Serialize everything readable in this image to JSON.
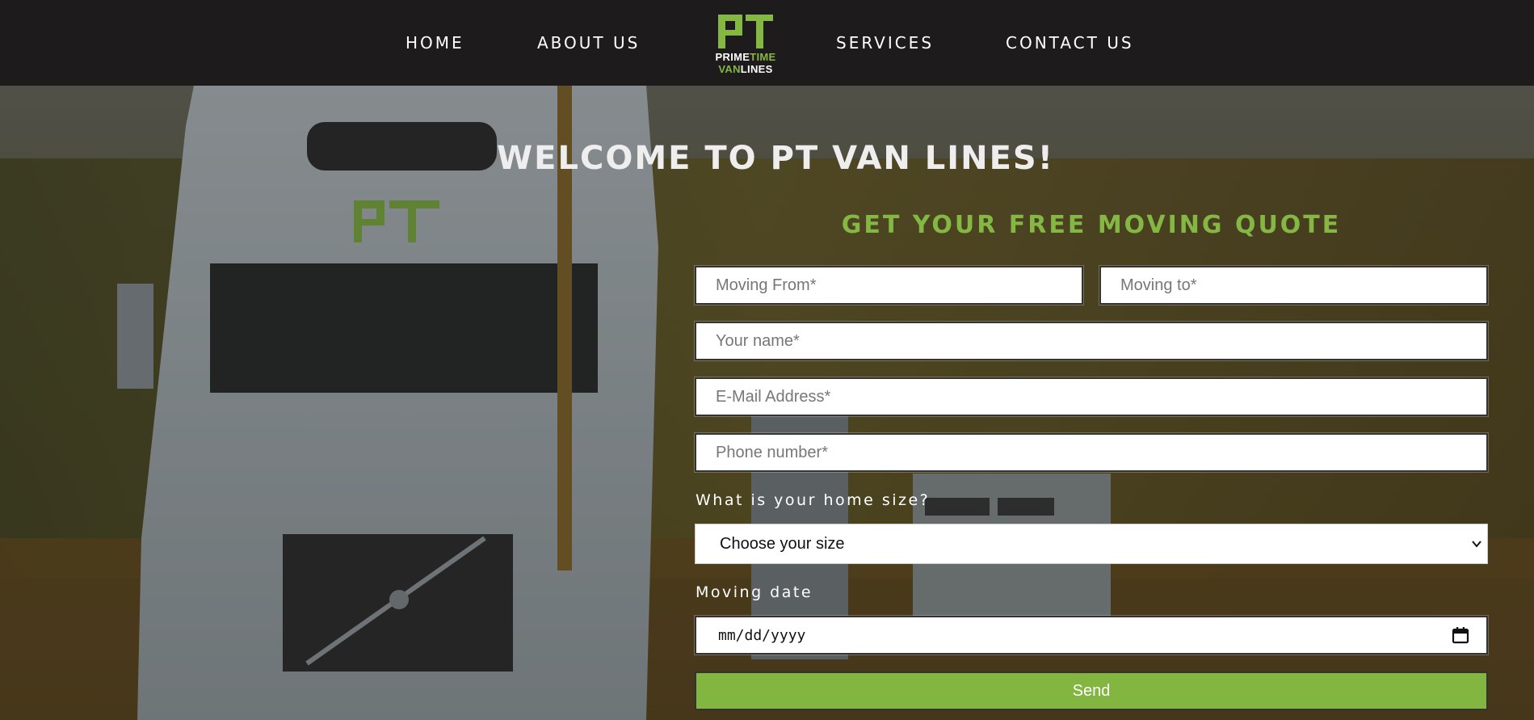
{
  "nav": {
    "home": "HOME",
    "about": "ABOUT US",
    "services": "SERVICES",
    "contact": "CONTACT US"
  },
  "logo": {
    "mark": "PT",
    "prime": "PRIME",
    "time": "TIME",
    "van": "VAN",
    "lines": "LINES"
  },
  "hero": {
    "welcome": "WELCOME TO PT VAN LINES!",
    "quote_title": "GET YOUR FREE MOVING QUOTE"
  },
  "form": {
    "moving_from_placeholder": "Moving From*",
    "moving_to_placeholder": "Moving to*",
    "name_placeholder": "Your name*",
    "email_placeholder": "E-Mail Address*",
    "phone_placeholder": "Phone number*",
    "home_size_label": "What is your home size?",
    "home_size_value": "Choose your size",
    "moving_date_label": "Moving date",
    "moving_date_value": "mm/dd/yyyy",
    "send_label": "Send"
  },
  "colors": {
    "brand_green": "#84b743",
    "header_bg": "#1e1b1d"
  },
  "icons": [
    "chevron-down-icon",
    "calendar-icon"
  ]
}
